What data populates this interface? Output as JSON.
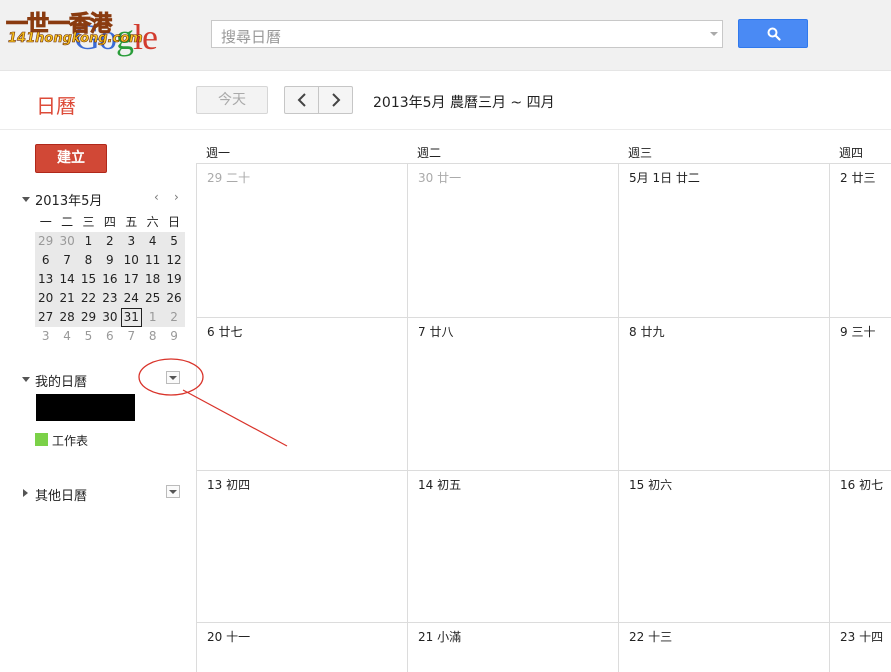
{
  "header": {
    "logo_top": "一世一香港",
    "logo_bottom": "141hongkong.com",
    "logo_word": [
      "G",
      "o",
      "g",
      "le"
    ],
    "search_placeholder": "搜尋日曆"
  },
  "toolbar": {
    "app_title": "日曆",
    "today_label": "今天",
    "date_range": "2013年5月 農曆三月 ~ 四月"
  },
  "sidebar": {
    "create_label": "建立",
    "mini_cal": {
      "title": "2013年5月",
      "dow": [
        "一",
        "二",
        "三",
        "四",
        "五",
        "六",
        "日"
      ],
      "weeks": [
        [
          "29",
          "30",
          "1",
          "2",
          "3",
          "4",
          "5"
        ],
        [
          "6",
          "7",
          "8",
          "9",
          "10",
          "11",
          "12"
        ],
        [
          "13",
          "14",
          "15",
          "16",
          "17",
          "18",
          "19"
        ],
        [
          "20",
          "21",
          "22",
          "23",
          "24",
          "25",
          "26"
        ],
        [
          "27",
          "28",
          "29",
          "30",
          "31",
          "1",
          "2"
        ],
        [
          "3",
          "4",
          "5",
          "6",
          "7",
          "8",
          "9"
        ]
      ]
    },
    "my_calendars_label": "我的日曆",
    "my_calendars": [
      {
        "name": "工作表",
        "color": "#7bd148"
      }
    ],
    "other_calendars_label": "其他日曆"
  },
  "month": {
    "dow": [
      "週一",
      "週二",
      "週三",
      "週四"
    ],
    "weeks": [
      [
        "29 二十",
        "30 廿一",
        "5月 1日 廿二",
        "2 廿三"
      ],
      [
        "6 廿七",
        "7 廿八",
        "8 廿九",
        "9 三十"
      ],
      [
        "13 初四",
        "14 初五",
        "15 初六",
        "16 初七"
      ],
      [
        "20 十一",
        "21 小滿",
        "22 十三",
        "23 十四"
      ]
    ]
  },
  "colors": {
    "accent_red": "#dd4b39",
    "create_button": "#d14836",
    "search_button": "#4a8af4",
    "annotation": "#d9332a"
  }
}
